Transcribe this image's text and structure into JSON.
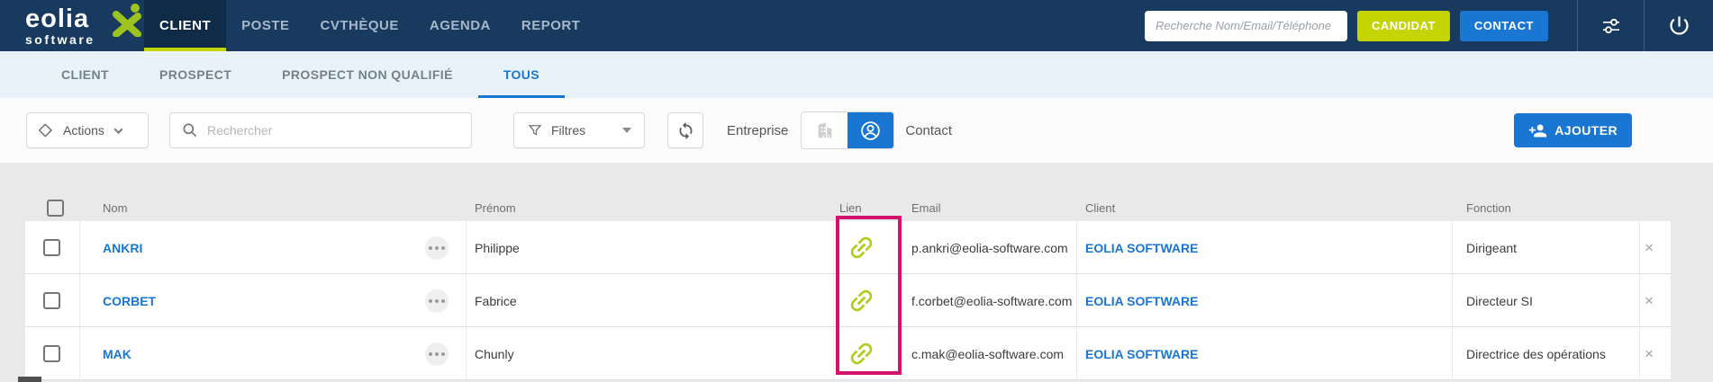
{
  "navbar": {
    "logo_line1": "eolia",
    "logo_line2": "software",
    "items": [
      {
        "label": "CLIENT"
      },
      {
        "label": "POSTE"
      },
      {
        "label": "CVTHÈQUE"
      },
      {
        "label": "AGENDA"
      },
      {
        "label": "REPORT"
      }
    ],
    "search_placeholder": "Recherche Nom/Email/Téléphone",
    "candidat_button": "CANDIDAT",
    "contact_button": "CONTACT"
  },
  "tabs": {
    "items": [
      {
        "label": "CLIENT"
      },
      {
        "label": "PROSPECT"
      },
      {
        "label": "PROSPECT NON QUALIFIÉ"
      },
      {
        "label": "TOUS",
        "active": true
      }
    ]
  },
  "toolbar": {
    "actions_label": "Actions",
    "search_placeholder": "Rechercher",
    "filtres_label": "Filtres",
    "entreprise_label": "Entreprise",
    "contact_label": "Contact",
    "ajouter_label": "AJOUTER"
  },
  "table": {
    "headers": {
      "nom": "Nom",
      "prenom": "Prénom",
      "lien": "Lien",
      "email": "Email",
      "client": "Client",
      "fonction": "Fonction"
    },
    "delete_symbol": "×",
    "rows": [
      {
        "nom": "ANKRI",
        "prenom": "Philippe",
        "email": "p.ankri@eolia-software.com",
        "client": "EOLIA SOFTWARE",
        "fonction": "Dirigeant"
      },
      {
        "nom": "CORBET",
        "prenom": "Fabrice",
        "email": "f.corbet@eolia-software.com",
        "client": "EOLIA SOFTWARE",
        "fonction": "Directeur SI"
      },
      {
        "nom": "MAK",
        "prenom": "Chunly",
        "email": "c.mak@eolia-software.com",
        "client": "EOLIA SOFTWARE",
        "fonction": "Directrice des opérations"
      }
    ]
  },
  "colors": {
    "navbar_navy": "#173a5e",
    "accent_green": "#c3d400",
    "accent_blue": "#1976d2",
    "highlight_pink": "#d4136e",
    "link_icon_green": "#b2cb17"
  }
}
